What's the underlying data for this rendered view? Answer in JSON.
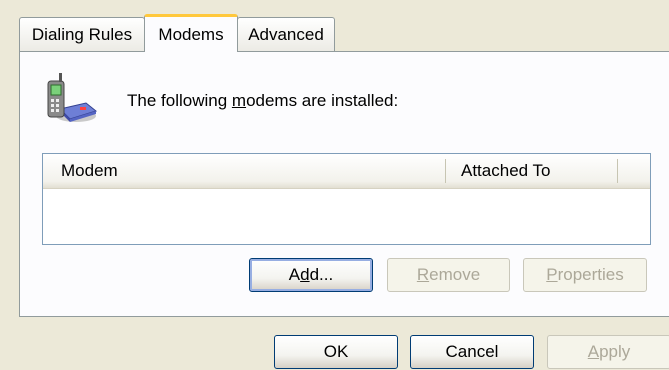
{
  "tabs": [
    {
      "label": "Dialing Rules",
      "selected": false
    },
    {
      "label": "Modems",
      "selected": true
    },
    {
      "label": "Advanced",
      "selected": false
    }
  ],
  "intro": {
    "prefix": "The following ",
    "mnemonic": "m",
    "rest": "odems are  installed:"
  },
  "modem_list": {
    "columns": [
      "Modem",
      "Attached To"
    ],
    "rows": []
  },
  "panel_buttons": {
    "add": {
      "pre": "A",
      "mnemonic": "d",
      "post": "d...",
      "enabled": true
    },
    "remove": {
      "pre": "",
      "mnemonic": "R",
      "post": "emove",
      "enabled": false
    },
    "properties": {
      "pre": "",
      "mnemonic": "P",
      "post": "roperties",
      "enabled": false
    }
  },
  "dialog_buttons": {
    "ok": "OK",
    "cancel": "Cancel",
    "apply": {
      "pre": "",
      "mnemonic": "A",
      "post": "pply",
      "enabled": false
    }
  },
  "icons": {
    "modem": "phone-modem-icon"
  },
  "colors": {
    "dialog_bg": "#ece9d8",
    "selected_tab_accent": "#ffc83c",
    "button_border": "#003c74",
    "disabled_text": "#aca899"
  }
}
